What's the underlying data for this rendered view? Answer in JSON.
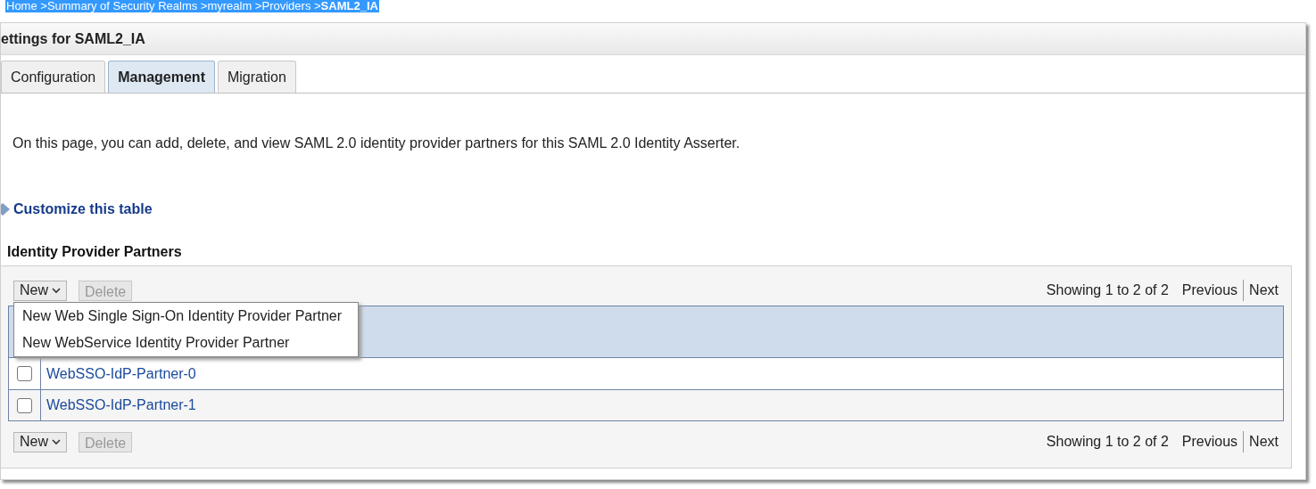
{
  "breadcrumb": [
    {
      "label": "Home >",
      "current": false
    },
    {
      "label": "Summary of Security Realms >",
      "current": false
    },
    {
      "label": "myrealm >",
      "current": false
    },
    {
      "label": "Providers >",
      "current": false
    },
    {
      "label": "SAML2_IA",
      "current": true
    }
  ],
  "title": "ettings for SAML2_IA",
  "tabs": [
    {
      "label": "Configuration",
      "selected": false
    },
    {
      "label": "Management",
      "selected": true
    },
    {
      "label": "Migration",
      "selected": false
    }
  ],
  "description": "On this page, you can add, delete, and view SAML 2.0 identity provider partners for this SAML 2.0 Identity Asserter.",
  "customize_link": "Customize this table",
  "table_title": "Identity Provider Partners",
  "toolbar_top": {
    "new": "New",
    "delete": "Delete",
    "delete_disabled": true,
    "showing": "Showing 1 to 2 of 2",
    "previous": "Previous",
    "next": "Next"
  },
  "new_menu": {
    "open": true,
    "items": [
      "New Web Single Sign-On Identity Provider Partner",
      "New WebService Identity Provider Partner"
    ]
  },
  "rows": [
    {
      "name": "WebSSO-IdP-Partner-0",
      "checked": false
    },
    {
      "name": "WebSSO-IdP-Partner-1",
      "checked": false
    }
  ],
  "toolbar_bottom": {
    "new": "New",
    "delete": "Delete",
    "delete_disabled": true,
    "showing": "Showing 1 to 2 of 2",
    "previous": "Previous",
    "next": "Next"
  }
}
